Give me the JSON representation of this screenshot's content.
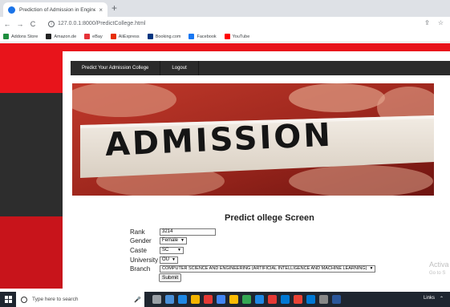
{
  "browser": {
    "tab_title": "Prediction of Admission in Engine",
    "tab_close": "×",
    "new_tab": "+",
    "back": "←",
    "forward": "→",
    "reload": "C",
    "url": "127.0.0.1:8000/PredictCollege.html",
    "bookmarks": [
      "Addons Store",
      "Amazon.de",
      "eBay",
      "AliExpress",
      "Booking.com",
      "Facebook",
      "YouTube"
    ],
    "bookmark_colors": [
      "#1e8e3e",
      "#222222",
      "#e53238",
      "#e62e04",
      "#003580",
      "#1877f2",
      "#ff0000"
    ]
  },
  "nav": {
    "predict_link": "Predict Your Admission College",
    "logout_link": "Logout"
  },
  "banner": {
    "text": "ADMISSION"
  },
  "form": {
    "title": "Predict ollege Screen",
    "rank_label": "Rank",
    "rank_value": "3214",
    "gender_label": "Gender",
    "gender_value": "Female",
    "caste_label": "Caste",
    "caste_value": "SC",
    "university_label": "University",
    "university_value": "OU",
    "branch_label": "Branch",
    "branch_value": "COMPUTER SCIENCE AND ENGINEERING (ARTIFICIAL INTELLIGENCE AND MACHINE LEARNING)",
    "submit_label": "Submit"
  },
  "watermark": {
    "line1": "Activa",
    "line2": "Go to S"
  },
  "taskbar": {
    "search_placeholder": "Type here to search",
    "tray_links": "Links",
    "app_colors": [
      "#9aa0a6",
      "#4a90d9",
      "#1e88e5",
      "#f4b400",
      "#e53935",
      "#4285f4",
      "#fbbc05",
      "#34a853",
      "#1e88e5",
      "#e53935",
      "#0078d4",
      "#ea4335",
      "#0078d4",
      "#888888",
      "#2b579a"
    ]
  }
}
